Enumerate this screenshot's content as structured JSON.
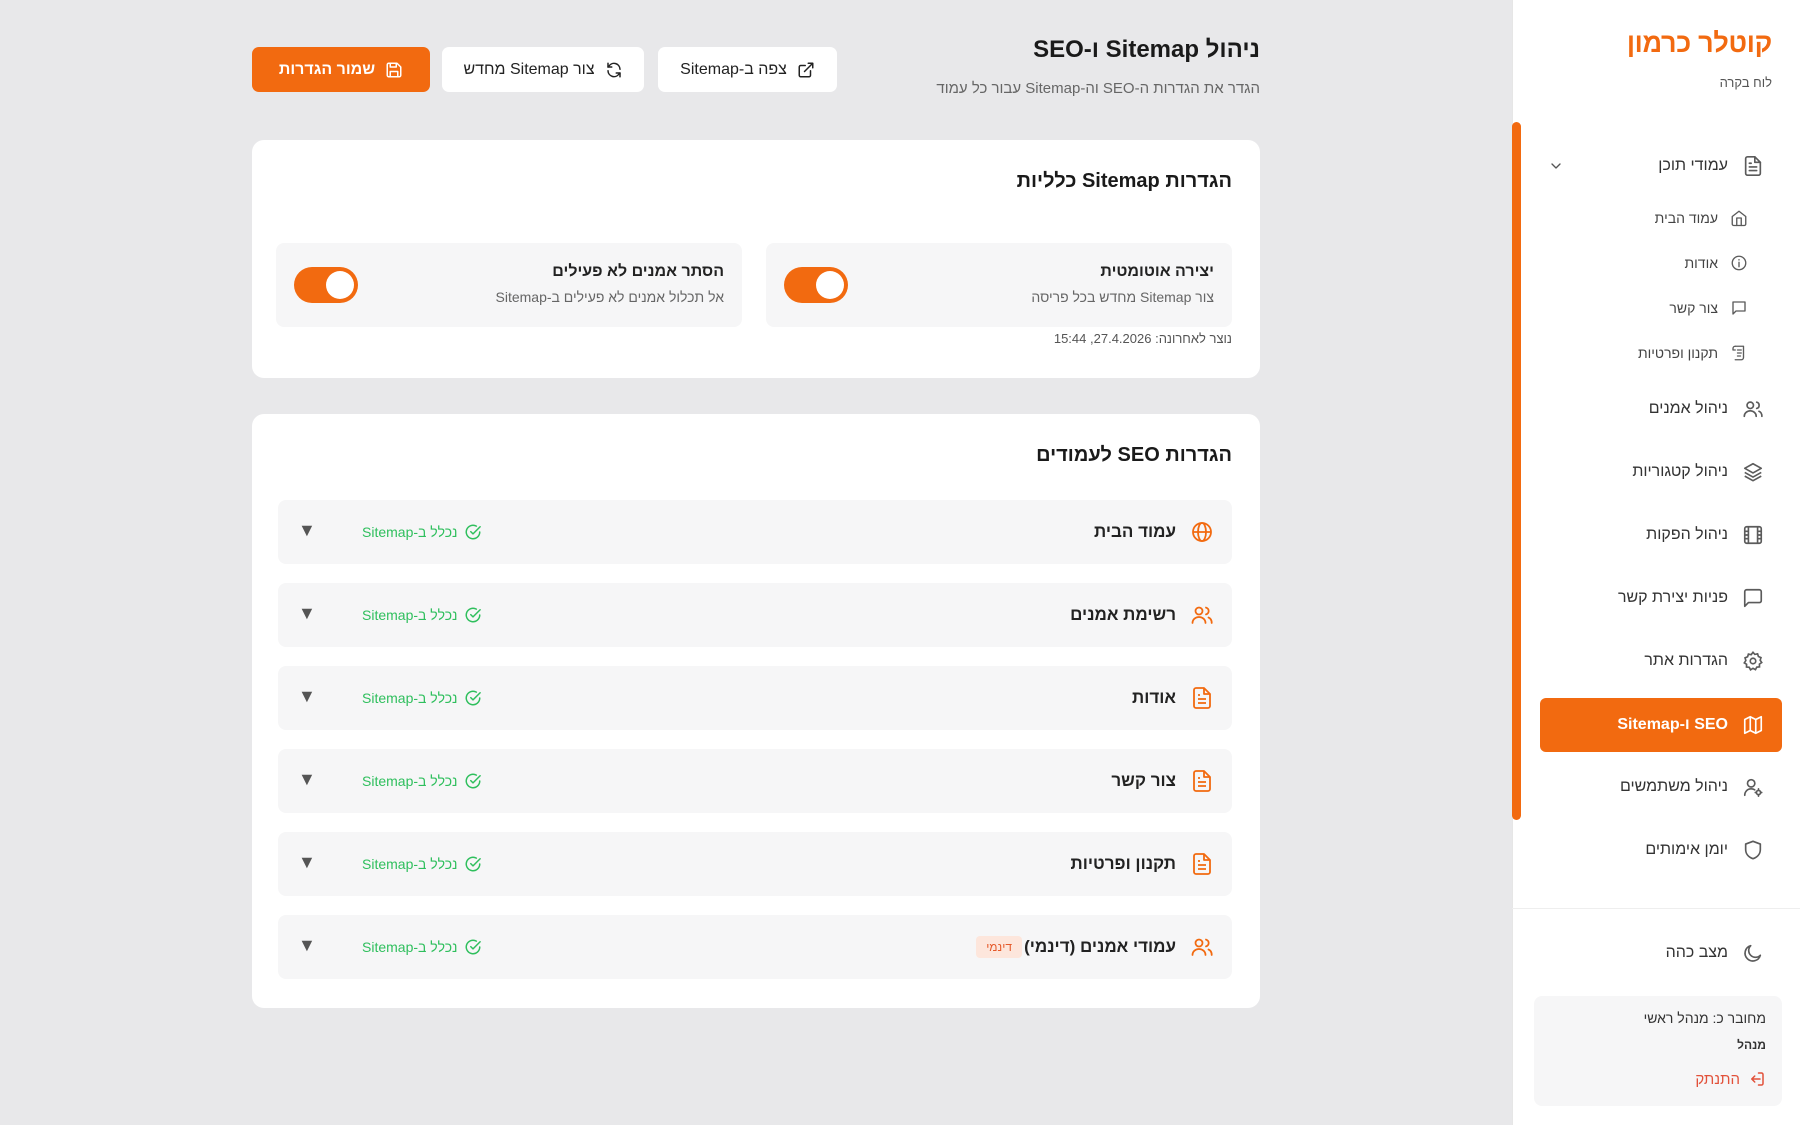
{
  "sidebar": {
    "brand_title": "קוטלר כרמון",
    "brand_sub": "לוח בקרה",
    "group": {
      "label": "עמודי תוכן"
    },
    "sub_items": [
      {
        "label": "עמוד הבית",
        "icon": "home-icon"
      },
      {
        "label": "אודות",
        "icon": "info-icon"
      },
      {
        "label": "צור קשר",
        "icon": "message-icon"
      },
      {
        "label": "תקנון ופרטיות",
        "icon": "scroll-icon"
      }
    ],
    "items": [
      {
        "label": "ניהול אמנים",
        "icon": "users-icon"
      },
      {
        "label": "ניהול קטגוריות",
        "icon": "layers-icon"
      },
      {
        "label": "ניהול הפקות",
        "icon": "film-icon"
      },
      {
        "label": "פניות יצירת קשר",
        "icon": "message-square-icon"
      },
      {
        "label": "הגדרות אתר",
        "icon": "gear-icon"
      },
      {
        "label": "SEO ו-Sitemap",
        "icon": "map-icon",
        "active": true
      },
      {
        "label": "ניהול משתמשים",
        "icon": "user-cog-icon"
      },
      {
        "label": "יומן אימותים",
        "icon": "shield-icon"
      }
    ],
    "dark_mode": "מצב כהה",
    "user": {
      "line1": "מחובר כ: מנהל ראשי",
      "role": "מנהל",
      "logout": "התנתק"
    }
  },
  "header": {
    "title": "ניהול Sitemap ו-SEO",
    "subtitle": "הגדר את הגדרות ה-SEO וה-Sitemap עבור כל עמוד",
    "btn_view": "צפה ב-Sitemap",
    "btn_regen": "צור Sitemap מחדש",
    "btn_save": "שמור הגדרות"
  },
  "general": {
    "title": "הגדרות Sitemap כלליות",
    "auto": {
      "title": "יצירה אוטומטית",
      "desc": "צור Sitemap מחדש בכל פריסה",
      "on": true
    },
    "hide": {
      "title": "הסתר אמנים לא פעילים",
      "desc": "אל תכלול אמנים לא פעילים ב-Sitemap",
      "on": true
    },
    "last_generated": "נוצר לאחרונה: 27.4.2026, 15:44"
  },
  "seo": {
    "title": "הגדרות SEO לעמודים",
    "status_label": "נכלל ב-Sitemap",
    "rows": [
      {
        "title": "עמוד הבית",
        "icon": "globe-icon"
      },
      {
        "title": "רשימת אמנים",
        "icon": "users-icon"
      },
      {
        "title": "אודות",
        "icon": "file-icon"
      },
      {
        "title": "צור קשר",
        "icon": "file-icon"
      },
      {
        "title": "תקנון ופרטיות",
        "icon": "file-icon"
      },
      {
        "title": "עמודי אמנים (דינמי)",
        "icon": "users-icon",
        "badge": "דינמי"
      }
    ]
  },
  "colors": {
    "accent": "#f26a10",
    "success": "#2fbf5d",
    "danger": "#e2513a"
  }
}
